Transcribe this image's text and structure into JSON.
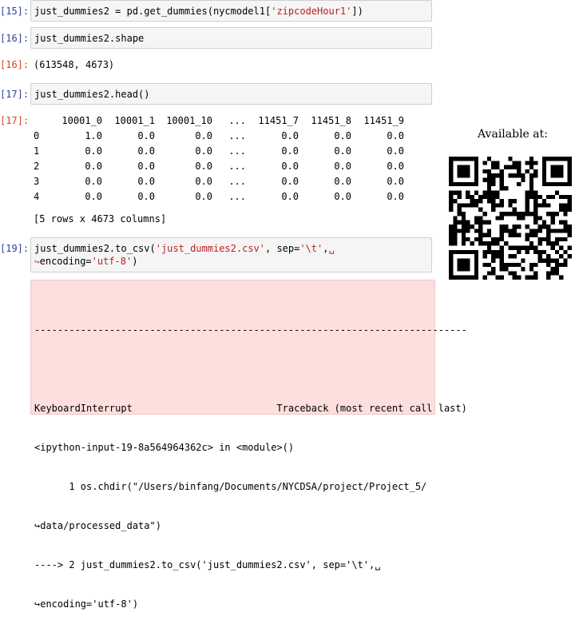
{
  "cells": {
    "c15": {
      "prompt": "[15]:",
      "code_prefix": "just_dummies2 = pd.get_dummies(nycmodel1[",
      "code_string": "'zipcodeHour1'",
      "code_suffix": "])"
    },
    "c16": {
      "prompt_in": "[16]:",
      "code": "just_dummies2.shape",
      "prompt_out": "[16]:",
      "output": "(613548, 4673)"
    },
    "c17": {
      "prompt_in": "[17]:",
      "code": "just_dummies2.head()",
      "prompt_out": "[17]:",
      "dataframe": {
        "columns": [
          "",
          "10001_0",
          "10001_1",
          "10001_10",
          "...",
          "11451_7",
          "11451_8",
          "11451_9"
        ],
        "rows": [
          [
            "0",
            "1.0",
            "0.0",
            "0.0",
            "...",
            "0.0",
            "0.0",
            "0.0"
          ],
          [
            "1",
            "0.0",
            "0.0",
            "0.0",
            "...",
            "0.0",
            "0.0",
            "0.0"
          ],
          [
            "2",
            "0.0",
            "0.0",
            "0.0",
            "...",
            "0.0",
            "0.0",
            "0.0"
          ],
          [
            "3",
            "0.0",
            "0.0",
            "0.0",
            "...",
            "0.0",
            "0.0",
            "0.0"
          ],
          [
            "4",
            "0.0",
            "0.0",
            "0.0",
            "...",
            "0.0",
            "0.0",
            "0.0"
          ]
        ],
        "footer": "[5 rows x 4673 columns]"
      }
    },
    "c19": {
      "prompt": "[19]:",
      "line1_prefix": "just_dummies2.to_csv(",
      "line1_str1": "'just_dummies2.csv'",
      "line1_mid": ", sep=",
      "line1_str2": "'\\t'",
      "line1_end": ",",
      "wrap_mark": "␣",
      "cont_arrow": "↪",
      "line2_prefix": "encoding=",
      "line2_str": "'utf-8'",
      "line2_suffix": ")"
    }
  },
  "error": {
    "lines": [
      "---------------------------------------------------------------------------",
      "",
      "KeyboardInterrupt                         Traceback (most recent call last)",
      "<ipython-input-19-8a564964362c> in <module>()",
      "      1 os.chdir(\"/Users/binfang/Documents/NYCDSA/project/Project_5/",
      "↪data/processed_data\")",
      "----> 2 just_dummies2.to_csv('just_dummies2.csv', sep='\\t',␣",
      "↪encoding='utf-8')"
    ]
  },
  "qr": {
    "label": "Available at:"
  },
  "colors": {
    "prompt_in": "#303F9F",
    "prompt_out": "#D84315",
    "string": "#BA2121",
    "operator": "#AA22FF",
    "cell_bg": "#f5f5f5",
    "error_bg": "#fddfdd"
  }
}
